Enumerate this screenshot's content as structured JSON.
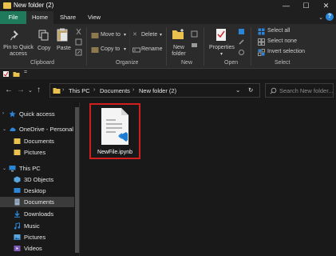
{
  "window": {
    "title": "New folder (2)",
    "controls": {
      "minimize": "—",
      "maximize": "☐",
      "close": "✕"
    }
  },
  "ribbon_tabs": {
    "file": "File",
    "home": "Home",
    "share": "Share",
    "view": "View",
    "collapse": "⌄",
    "help": "?"
  },
  "ribbon": {
    "clipboard": {
      "pin": "Pin to Quick access",
      "copy": "Copy",
      "paste": "Paste",
      "label": "Clipboard"
    },
    "organize": {
      "move_to": "Move to",
      "copy_to": "Copy to",
      "delete": "Delete",
      "rename": "Rename",
      "label": "Organize"
    },
    "new": {
      "new_folder": "New folder",
      "label": "New"
    },
    "open": {
      "properties": "Properties",
      "label": "Open"
    },
    "select": {
      "select_all": "Select all",
      "select_none": "Select none",
      "invert_selection": "Invert selection",
      "label": "Select"
    }
  },
  "qat": {
    "dropdown": "="
  },
  "nav": {
    "back": "←",
    "forward": "→",
    "recent": "⌄",
    "up": "↑",
    "breadcrumb": [
      "This PC",
      "Documents",
      "New folder (2)"
    ],
    "breadcrumb_sep": "›",
    "address_dropdown": "⌄",
    "refresh": "↻"
  },
  "search": {
    "placeholder": "Search New folder..."
  },
  "sidebar": {
    "items": [
      {
        "label": "Quick access",
        "icon": "star-icon",
        "level": 0
      },
      {
        "label": "OneDrive - Personal",
        "icon": "cloud-icon",
        "level": 0
      },
      {
        "label": "Documents",
        "icon": "folder-icon",
        "level": 1
      },
      {
        "label": "Pictures",
        "icon": "folder-icon",
        "level": 1
      },
      {
        "label": "This PC",
        "icon": "computer-icon",
        "level": 0
      },
      {
        "label": "3D Objects",
        "icon": "cube-icon",
        "level": 1
      },
      {
        "label": "Desktop",
        "icon": "desktop-icon",
        "level": 1
      },
      {
        "label": "Documents",
        "icon": "documents-icon",
        "level": 1,
        "selected": true
      },
      {
        "label": "Downloads",
        "icon": "download-icon",
        "level": 1
      },
      {
        "label": "Music",
        "icon": "music-icon",
        "level": 1
      },
      {
        "label": "Pictures",
        "icon": "pictures-icon",
        "level": 1
      },
      {
        "label": "Videos",
        "icon": "videos-icon",
        "level": 1
      }
    ]
  },
  "files": [
    {
      "name": "NewFile.ipynb",
      "icon": "ipynb-file-icon",
      "selected": true
    }
  ],
  "colors": {
    "accent_file_tab": "#1e7a5a",
    "folder_yellow": "#e8c14f",
    "highlight_red": "#d11f1f",
    "vscode_blue": "#2b86d8"
  }
}
